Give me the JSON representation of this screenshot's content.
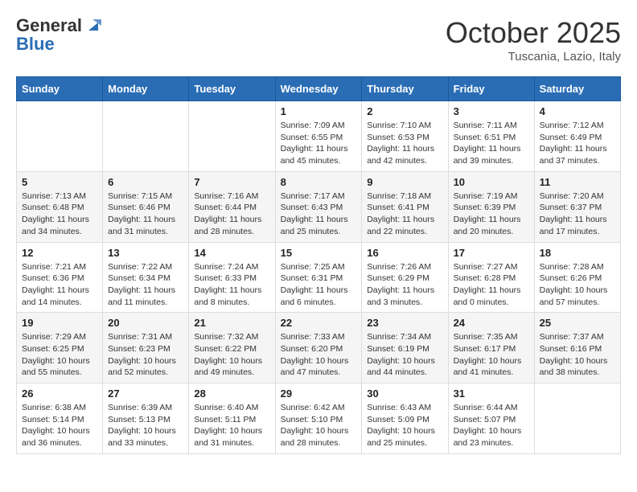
{
  "header": {
    "logo_general": "General",
    "logo_blue": "Blue",
    "month_title": "October 2025",
    "subtitle": "Tuscania, Lazio, Italy"
  },
  "weekdays": [
    "Sunday",
    "Monday",
    "Tuesday",
    "Wednesday",
    "Thursday",
    "Friday",
    "Saturday"
  ],
  "weeks": [
    [
      {
        "day": "",
        "info": ""
      },
      {
        "day": "",
        "info": ""
      },
      {
        "day": "",
        "info": ""
      },
      {
        "day": "1",
        "info": "Sunrise: 7:09 AM\nSunset: 6:55 PM\nDaylight: 11 hours and 45 minutes."
      },
      {
        "day": "2",
        "info": "Sunrise: 7:10 AM\nSunset: 6:53 PM\nDaylight: 11 hours and 42 minutes."
      },
      {
        "day": "3",
        "info": "Sunrise: 7:11 AM\nSunset: 6:51 PM\nDaylight: 11 hours and 39 minutes."
      },
      {
        "day": "4",
        "info": "Sunrise: 7:12 AM\nSunset: 6:49 PM\nDaylight: 11 hours and 37 minutes."
      }
    ],
    [
      {
        "day": "5",
        "info": "Sunrise: 7:13 AM\nSunset: 6:48 PM\nDaylight: 11 hours and 34 minutes."
      },
      {
        "day": "6",
        "info": "Sunrise: 7:15 AM\nSunset: 6:46 PM\nDaylight: 11 hours and 31 minutes."
      },
      {
        "day": "7",
        "info": "Sunrise: 7:16 AM\nSunset: 6:44 PM\nDaylight: 11 hours and 28 minutes."
      },
      {
        "day": "8",
        "info": "Sunrise: 7:17 AM\nSunset: 6:43 PM\nDaylight: 11 hours and 25 minutes."
      },
      {
        "day": "9",
        "info": "Sunrise: 7:18 AM\nSunset: 6:41 PM\nDaylight: 11 hours and 22 minutes."
      },
      {
        "day": "10",
        "info": "Sunrise: 7:19 AM\nSunset: 6:39 PM\nDaylight: 11 hours and 20 minutes."
      },
      {
        "day": "11",
        "info": "Sunrise: 7:20 AM\nSunset: 6:37 PM\nDaylight: 11 hours and 17 minutes."
      }
    ],
    [
      {
        "day": "12",
        "info": "Sunrise: 7:21 AM\nSunset: 6:36 PM\nDaylight: 11 hours and 14 minutes."
      },
      {
        "day": "13",
        "info": "Sunrise: 7:22 AM\nSunset: 6:34 PM\nDaylight: 11 hours and 11 minutes."
      },
      {
        "day": "14",
        "info": "Sunrise: 7:24 AM\nSunset: 6:33 PM\nDaylight: 11 hours and 8 minutes."
      },
      {
        "day": "15",
        "info": "Sunrise: 7:25 AM\nSunset: 6:31 PM\nDaylight: 11 hours and 6 minutes."
      },
      {
        "day": "16",
        "info": "Sunrise: 7:26 AM\nSunset: 6:29 PM\nDaylight: 11 hours and 3 minutes."
      },
      {
        "day": "17",
        "info": "Sunrise: 7:27 AM\nSunset: 6:28 PM\nDaylight: 11 hours and 0 minutes."
      },
      {
        "day": "18",
        "info": "Sunrise: 7:28 AM\nSunset: 6:26 PM\nDaylight: 10 hours and 57 minutes."
      }
    ],
    [
      {
        "day": "19",
        "info": "Sunrise: 7:29 AM\nSunset: 6:25 PM\nDaylight: 10 hours and 55 minutes."
      },
      {
        "day": "20",
        "info": "Sunrise: 7:31 AM\nSunset: 6:23 PM\nDaylight: 10 hours and 52 minutes."
      },
      {
        "day": "21",
        "info": "Sunrise: 7:32 AM\nSunset: 6:22 PM\nDaylight: 10 hours and 49 minutes."
      },
      {
        "day": "22",
        "info": "Sunrise: 7:33 AM\nSunset: 6:20 PM\nDaylight: 10 hours and 47 minutes."
      },
      {
        "day": "23",
        "info": "Sunrise: 7:34 AM\nSunset: 6:19 PM\nDaylight: 10 hours and 44 minutes."
      },
      {
        "day": "24",
        "info": "Sunrise: 7:35 AM\nSunset: 6:17 PM\nDaylight: 10 hours and 41 minutes."
      },
      {
        "day": "25",
        "info": "Sunrise: 7:37 AM\nSunset: 6:16 PM\nDaylight: 10 hours and 38 minutes."
      }
    ],
    [
      {
        "day": "26",
        "info": "Sunrise: 6:38 AM\nSunset: 5:14 PM\nDaylight: 10 hours and 36 minutes."
      },
      {
        "day": "27",
        "info": "Sunrise: 6:39 AM\nSunset: 5:13 PM\nDaylight: 10 hours and 33 minutes."
      },
      {
        "day": "28",
        "info": "Sunrise: 6:40 AM\nSunset: 5:11 PM\nDaylight: 10 hours and 31 minutes."
      },
      {
        "day": "29",
        "info": "Sunrise: 6:42 AM\nSunset: 5:10 PM\nDaylight: 10 hours and 28 minutes."
      },
      {
        "day": "30",
        "info": "Sunrise: 6:43 AM\nSunset: 5:09 PM\nDaylight: 10 hours and 25 minutes."
      },
      {
        "day": "31",
        "info": "Sunrise: 6:44 AM\nSunset: 5:07 PM\nDaylight: 10 hours and 23 minutes."
      },
      {
        "day": "",
        "info": ""
      }
    ]
  ]
}
